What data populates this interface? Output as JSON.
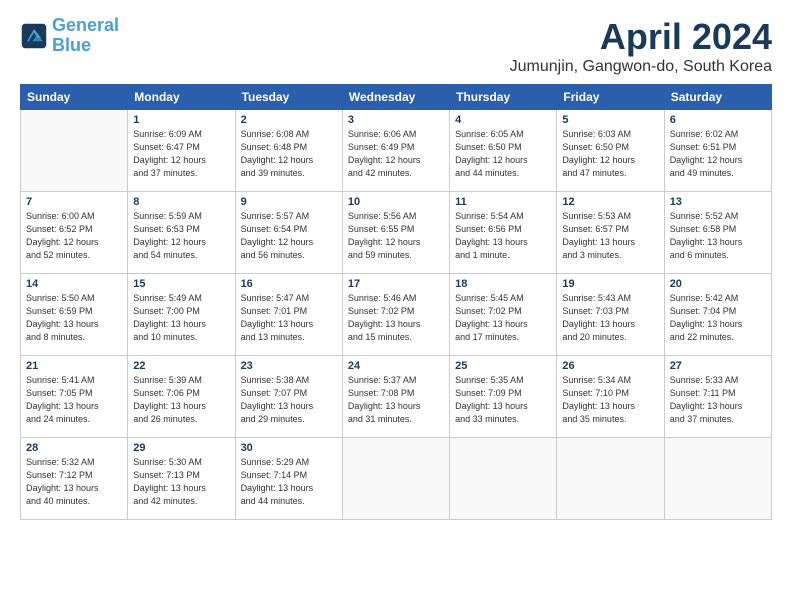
{
  "header": {
    "logo_line1": "General",
    "logo_line2": "Blue",
    "title": "April 2024",
    "subtitle": "Jumunjin, Gangwon-do, South Korea"
  },
  "weekdays": [
    "Sunday",
    "Monday",
    "Tuesday",
    "Wednesday",
    "Thursday",
    "Friday",
    "Saturday"
  ],
  "weeks": [
    [
      {
        "day": "",
        "info": ""
      },
      {
        "day": "1",
        "info": "Sunrise: 6:09 AM\nSunset: 6:47 PM\nDaylight: 12 hours\nand 37 minutes."
      },
      {
        "day": "2",
        "info": "Sunrise: 6:08 AM\nSunset: 6:48 PM\nDaylight: 12 hours\nand 39 minutes."
      },
      {
        "day": "3",
        "info": "Sunrise: 6:06 AM\nSunset: 6:49 PM\nDaylight: 12 hours\nand 42 minutes."
      },
      {
        "day": "4",
        "info": "Sunrise: 6:05 AM\nSunset: 6:50 PM\nDaylight: 12 hours\nand 44 minutes."
      },
      {
        "day": "5",
        "info": "Sunrise: 6:03 AM\nSunset: 6:50 PM\nDaylight: 12 hours\nand 47 minutes."
      },
      {
        "day": "6",
        "info": "Sunrise: 6:02 AM\nSunset: 6:51 PM\nDaylight: 12 hours\nand 49 minutes."
      }
    ],
    [
      {
        "day": "7",
        "info": "Sunrise: 6:00 AM\nSunset: 6:52 PM\nDaylight: 12 hours\nand 52 minutes."
      },
      {
        "day": "8",
        "info": "Sunrise: 5:59 AM\nSunset: 6:53 PM\nDaylight: 12 hours\nand 54 minutes."
      },
      {
        "day": "9",
        "info": "Sunrise: 5:57 AM\nSunset: 6:54 PM\nDaylight: 12 hours\nand 56 minutes."
      },
      {
        "day": "10",
        "info": "Sunrise: 5:56 AM\nSunset: 6:55 PM\nDaylight: 12 hours\nand 59 minutes."
      },
      {
        "day": "11",
        "info": "Sunrise: 5:54 AM\nSunset: 6:56 PM\nDaylight: 13 hours\nand 1 minute."
      },
      {
        "day": "12",
        "info": "Sunrise: 5:53 AM\nSunset: 6:57 PM\nDaylight: 13 hours\nand 3 minutes."
      },
      {
        "day": "13",
        "info": "Sunrise: 5:52 AM\nSunset: 6:58 PM\nDaylight: 13 hours\nand 6 minutes."
      }
    ],
    [
      {
        "day": "14",
        "info": "Sunrise: 5:50 AM\nSunset: 6:59 PM\nDaylight: 13 hours\nand 8 minutes."
      },
      {
        "day": "15",
        "info": "Sunrise: 5:49 AM\nSunset: 7:00 PM\nDaylight: 13 hours\nand 10 minutes."
      },
      {
        "day": "16",
        "info": "Sunrise: 5:47 AM\nSunset: 7:01 PM\nDaylight: 13 hours\nand 13 minutes."
      },
      {
        "day": "17",
        "info": "Sunrise: 5:46 AM\nSunset: 7:02 PM\nDaylight: 13 hours\nand 15 minutes."
      },
      {
        "day": "18",
        "info": "Sunrise: 5:45 AM\nSunset: 7:02 PM\nDaylight: 13 hours\nand 17 minutes."
      },
      {
        "day": "19",
        "info": "Sunrise: 5:43 AM\nSunset: 7:03 PM\nDaylight: 13 hours\nand 20 minutes."
      },
      {
        "day": "20",
        "info": "Sunrise: 5:42 AM\nSunset: 7:04 PM\nDaylight: 13 hours\nand 22 minutes."
      }
    ],
    [
      {
        "day": "21",
        "info": "Sunrise: 5:41 AM\nSunset: 7:05 PM\nDaylight: 13 hours\nand 24 minutes."
      },
      {
        "day": "22",
        "info": "Sunrise: 5:39 AM\nSunset: 7:06 PM\nDaylight: 13 hours\nand 26 minutes."
      },
      {
        "day": "23",
        "info": "Sunrise: 5:38 AM\nSunset: 7:07 PM\nDaylight: 13 hours\nand 29 minutes."
      },
      {
        "day": "24",
        "info": "Sunrise: 5:37 AM\nSunset: 7:08 PM\nDaylight: 13 hours\nand 31 minutes."
      },
      {
        "day": "25",
        "info": "Sunrise: 5:35 AM\nSunset: 7:09 PM\nDaylight: 13 hours\nand 33 minutes."
      },
      {
        "day": "26",
        "info": "Sunrise: 5:34 AM\nSunset: 7:10 PM\nDaylight: 13 hours\nand 35 minutes."
      },
      {
        "day": "27",
        "info": "Sunrise: 5:33 AM\nSunset: 7:11 PM\nDaylight: 13 hours\nand 37 minutes."
      }
    ],
    [
      {
        "day": "28",
        "info": "Sunrise: 5:32 AM\nSunset: 7:12 PM\nDaylight: 13 hours\nand 40 minutes."
      },
      {
        "day": "29",
        "info": "Sunrise: 5:30 AM\nSunset: 7:13 PM\nDaylight: 13 hours\nand 42 minutes."
      },
      {
        "day": "30",
        "info": "Sunrise: 5:29 AM\nSunset: 7:14 PM\nDaylight: 13 hours\nand 44 minutes."
      },
      {
        "day": "",
        "info": ""
      },
      {
        "day": "",
        "info": ""
      },
      {
        "day": "",
        "info": ""
      },
      {
        "day": "",
        "info": ""
      }
    ]
  ]
}
